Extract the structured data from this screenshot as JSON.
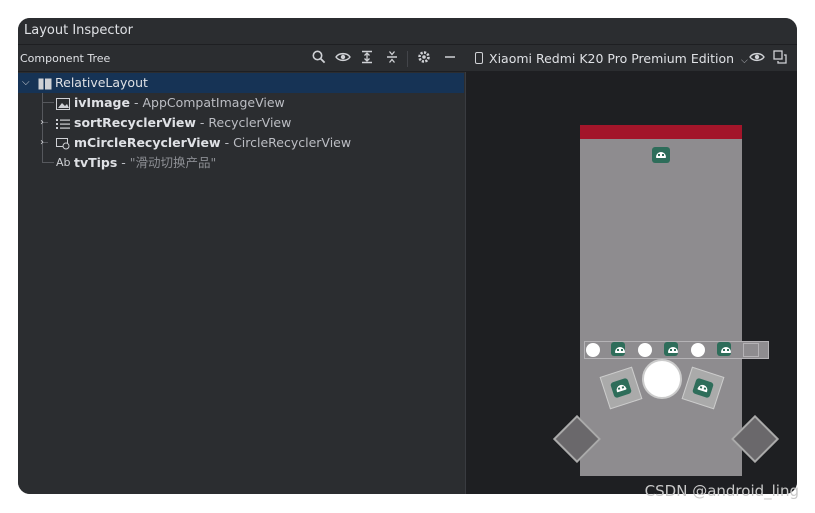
{
  "window": {
    "title": "Layout Inspector"
  },
  "toolbar": {
    "label": "Component Tree",
    "icons": [
      "search-icon",
      "eye-icon",
      "expand-all-icon",
      "collapse-all-icon",
      "gear-icon",
      "minimize-icon"
    ],
    "device_name": "Xiaomi Redmi K20 Pro Premium Edition",
    "right_icons": [
      "eye-icon",
      "copy-frame-icon"
    ]
  },
  "tree": [
    {
      "name": "RelativeLayout",
      "type": "",
      "text": "",
      "icon": "layout-icon",
      "expandable": true,
      "expanded": true,
      "selected": true
    },
    {
      "name": "ivImage",
      "type": "AppCompatImageView",
      "text": "",
      "icon": "image-icon",
      "expandable": false
    },
    {
      "name": "sortRecyclerView",
      "type": "RecyclerView",
      "text": "",
      "icon": "list-icon",
      "expandable": true,
      "expanded": false
    },
    {
      "name": "mCircleRecyclerView",
      "type": "CircleRecyclerView",
      "text": "",
      "icon": "circle-list-icon",
      "expandable": true,
      "expanded": false
    },
    {
      "name": "tvTips",
      "type": "",
      "text": "\"滑动切换产品\"",
      "icon": "text-icon",
      "icon_text": "Ab",
      "expandable": false
    }
  ],
  "separator": " - ",
  "colors": {
    "accent": "#163355",
    "status_bar": "#a3152a",
    "android_green": "#2e6d5a"
  },
  "watermark": "CSDN @android_ling"
}
